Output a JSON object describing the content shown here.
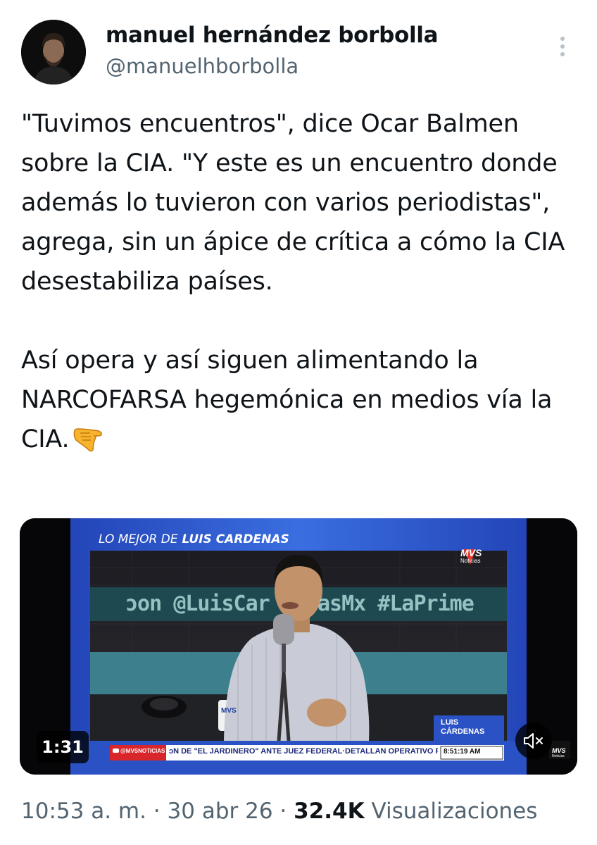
{
  "author": {
    "name": "manuel hernández borbolla",
    "handle": "@manuelhborbolla",
    "avatar_icon": "user-avatar-photo"
  },
  "post": {
    "text": "\"Tuvimos encuentros\", dice Ocar Balmen sobre la CIA. \"Y este es un encuentro donde además lo tuvieron con varios periodistas\", agrega, sin un ápice de crítica a cómo la CIA desestabiliza países.\n\nAsí opera y así siguen alimentando la NARCOFARSA hegemónica en medios vía la CIA.",
    "emoji_icon": "backhand-index-pointing-down-icon"
  },
  "video": {
    "duration": "1:31",
    "mute_icon": "speaker-muted-icon",
    "show_title_prefix": "LO MEJOR DE",
    "show_title_name": "LUIS CARDENAS",
    "channel_logo": "MVS",
    "channel_logo_sub": "Noticias",
    "wall_hashtags": "ɔon @LuisCar    asMx #LaPrime",
    "host_label_line1": "LUIS",
    "host_label_line2": "CÁRDENAS",
    "ticker_source": "@MVSNOTICIAS",
    "ticker_text": "ɔN DE \"EL JARDINERO\" ANTE JUEZ FEDERAL·DETALLAN OPERATIVO PARA DET",
    "clock": "8:51:19 AM",
    "corner_logo": "MVS",
    "corner_logo_sub": "Noticias",
    "mug_text": "MVS",
    "colors": {
      "frame_blue": "#2f5fd0",
      "ticker_red": "#d8262b",
      "studio_teal": "#3d7f8c"
    }
  },
  "meta": {
    "time": "10:53 a. m.",
    "separator": " · ",
    "date": "30 abr 26",
    "views_count": "32.4K",
    "views_label": "Visualizaciones"
  }
}
